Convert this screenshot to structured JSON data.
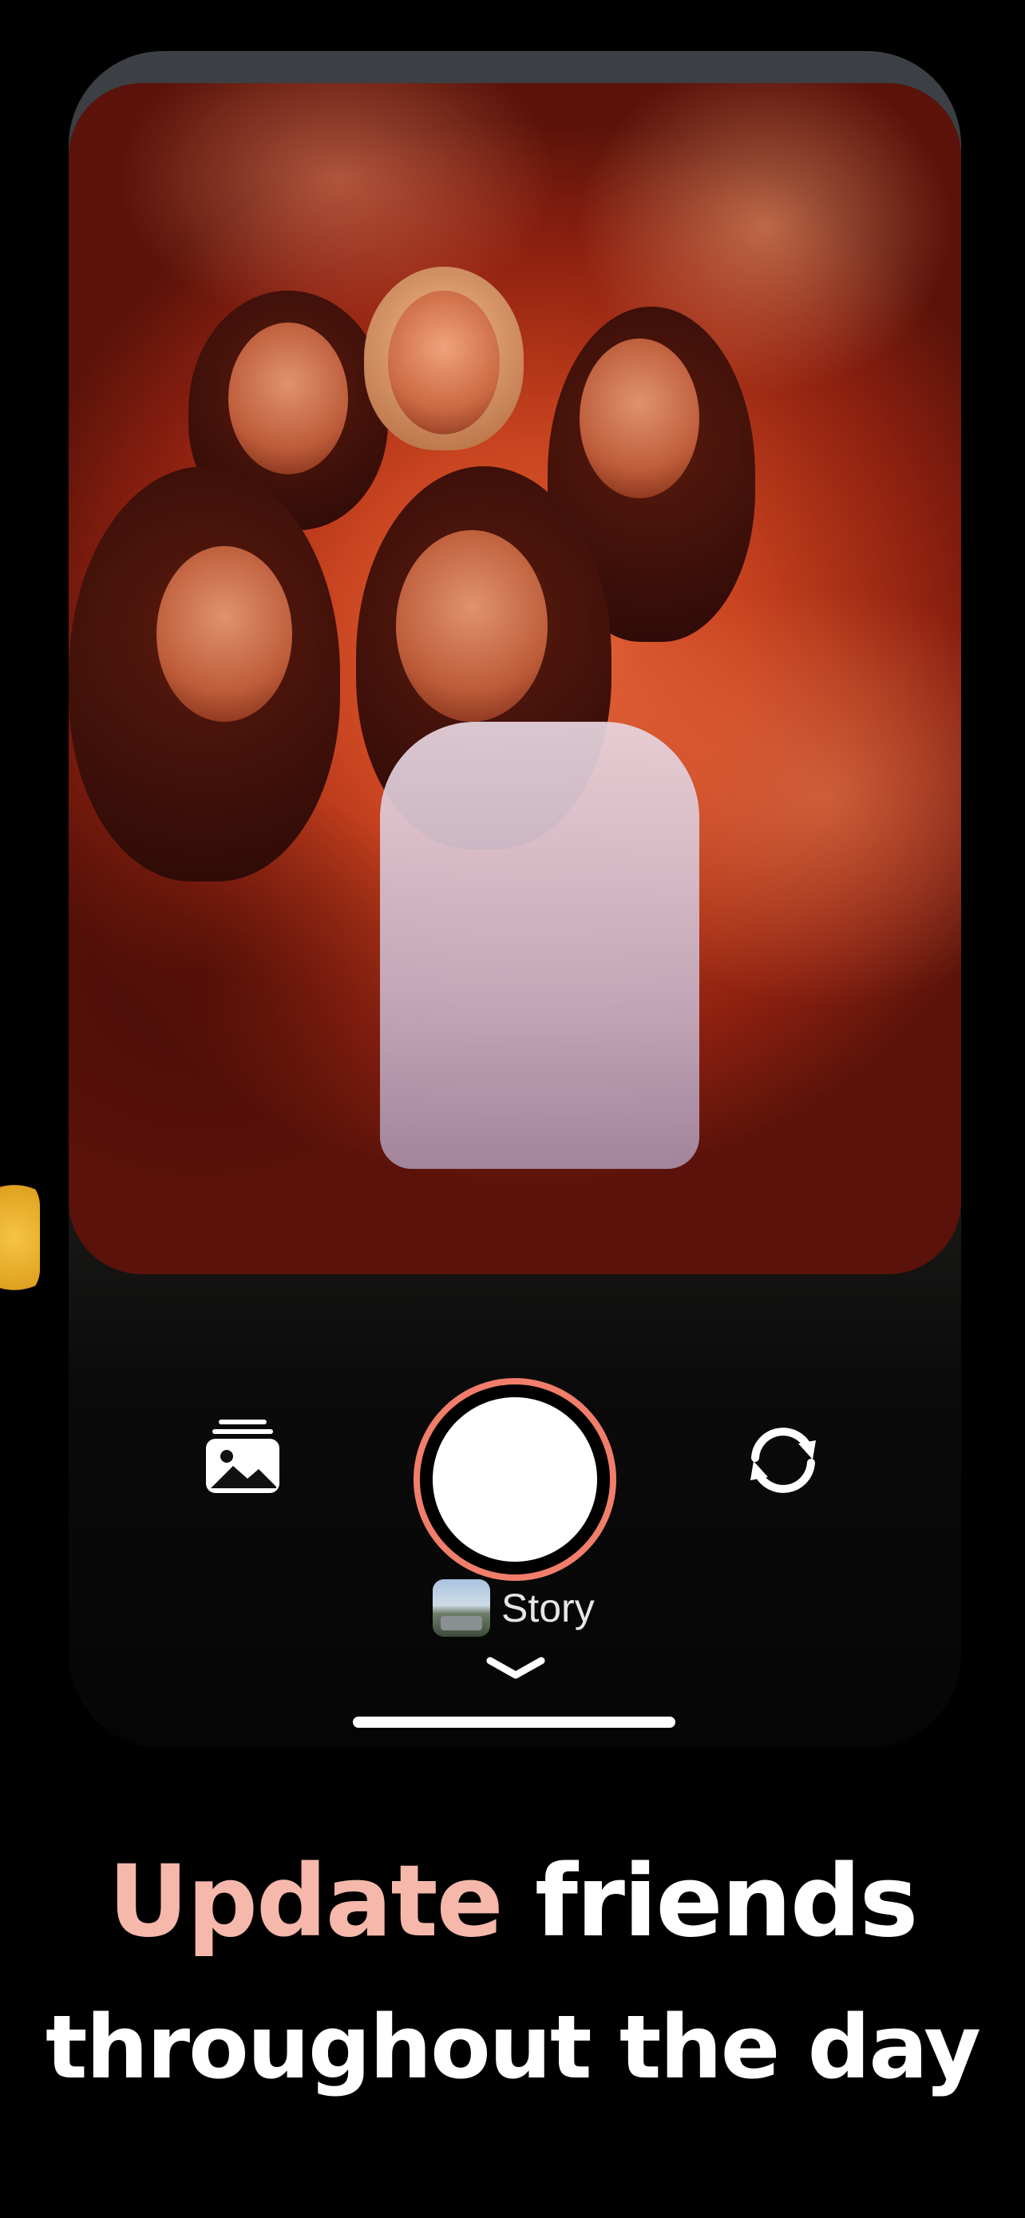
{
  "camera": {
    "gallery_icon": "photo-stack-icon",
    "shutter_icon": "shutter-icon",
    "flip_icon": "camera-flip-icon",
    "accent_color": "#f07e6a"
  },
  "story": {
    "label": "Story",
    "chevron_icon": "chevron-down-icon"
  },
  "headline": {
    "highlight": "Update",
    "rest_line1": "friends",
    "line2": "throughout the day",
    "highlight_color": "#f5b8aa"
  }
}
